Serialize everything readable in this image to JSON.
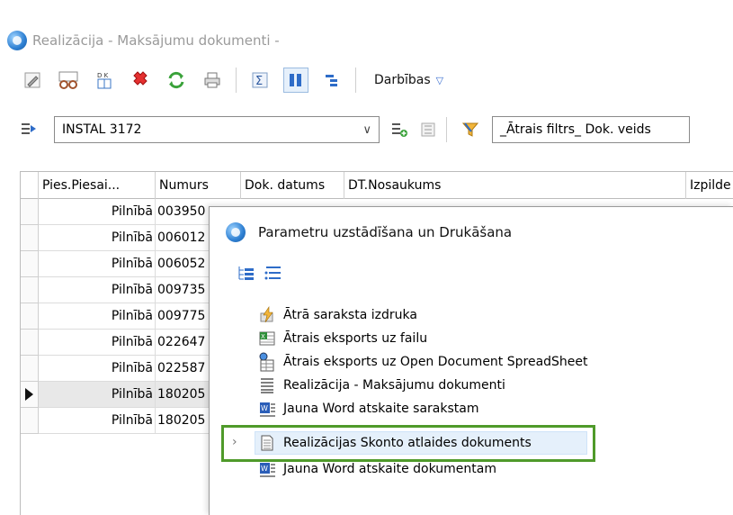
{
  "window": {
    "title": "Realizācija - Maksājumu dokumenti -"
  },
  "toolbar": {
    "actions_label": "Darbības"
  },
  "filterbar": {
    "combo_value": "INSTAL 3172",
    "quick_filter": "_Ātrais filtrs_ Dok. veids"
  },
  "grid": {
    "columns": [
      "Pies.Piesai...",
      "Numurs",
      "Dok. datums",
      "DT.Nosaukums",
      "Izpilde"
    ],
    "rows": [
      {
        "pies": "Pilnībā",
        "num": "003950"
      },
      {
        "pies": "Pilnībā",
        "num": "006012"
      },
      {
        "pies": "Pilnībā",
        "num": "006052"
      },
      {
        "pies": "Pilnībā",
        "num": "009735"
      },
      {
        "pies": "Pilnībā",
        "num": "009775"
      },
      {
        "pies": "Pilnībā",
        "num": "022647"
      },
      {
        "pies": "Pilnībā",
        "num": "022587"
      },
      {
        "pies": "Pilnībā",
        "num": "180205"
      },
      {
        "pies": "Pilnībā",
        "num": "180205"
      }
    ]
  },
  "dialog": {
    "title": "Parametru uzstādīšana un Drukāšana",
    "items": [
      {
        "label": "Ātrā saraksta izdruka",
        "icon": "lightning-print-icon"
      },
      {
        "label": "Ātrais eksports uz failu",
        "icon": "excel-export-icon"
      },
      {
        "label": "Ātrais eksports uz Open Document SpreadSheet",
        "icon": "ods-export-icon"
      },
      {
        "label": "Realizācija - Maksājumu dokumenti",
        "icon": "report-list-icon"
      },
      {
        "label": "Jauna Word atskaite sarakstam",
        "icon": "word-report-icon"
      },
      {
        "label": "Realizācijas Skonto atlaides dokuments",
        "icon": "document-icon"
      },
      {
        "label": "Jauna Word atskaite dokumentam",
        "icon": "word-report-icon"
      }
    ]
  },
  "colors": {
    "highlight_border": "#4f9a2a",
    "selection_bg": "#e5f0fb"
  }
}
